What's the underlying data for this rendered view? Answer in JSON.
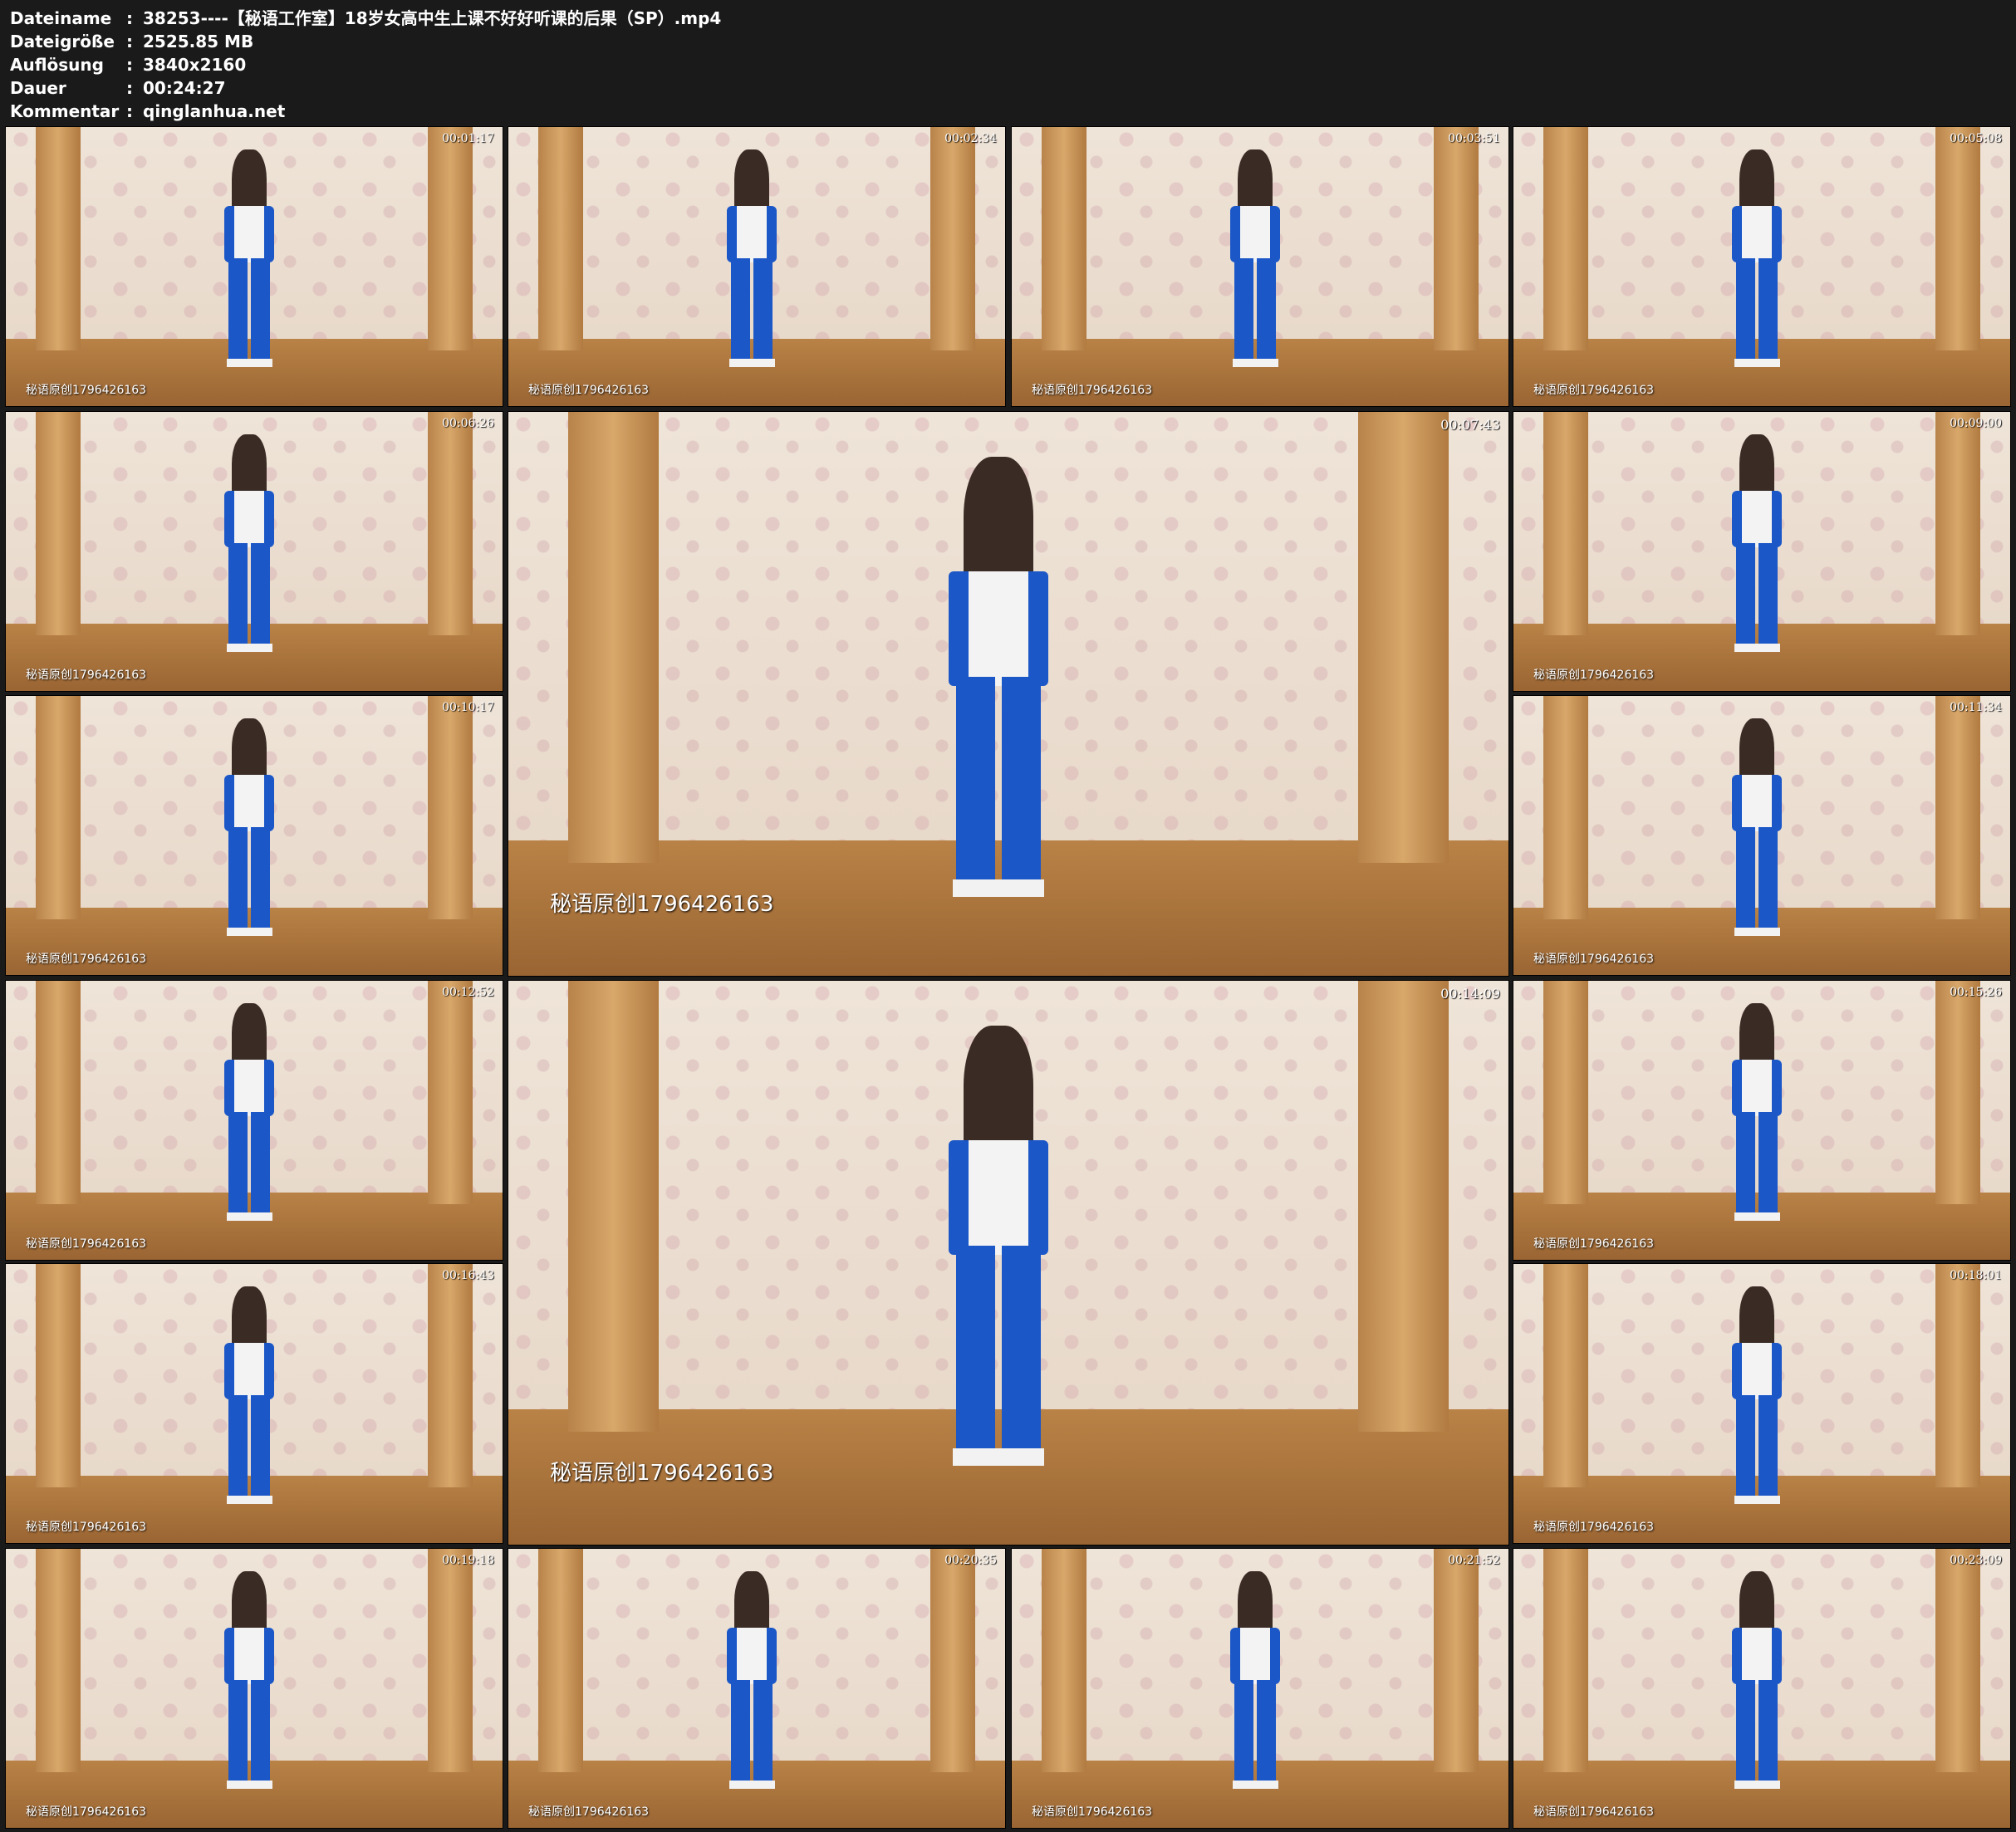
{
  "file_info": [
    {
      "key": "Dateiname",
      "value": "38253----【秘语工作室】18岁女高中生上课不好好听课的后果（SP）.mp4"
    },
    {
      "key": "Dateigröße",
      "value": "2525.85 MB"
    },
    {
      "key": "Auflösung",
      "value": "3840x2160"
    },
    {
      "key": "Dauer",
      "value": "00:24:27"
    },
    {
      "key": "Kommentar",
      "value": "qinglanhua.net"
    }
  ],
  "separator": ":",
  "watermark": "秘语原创1796426163",
  "thumbnails": [
    {
      "timestamp": "00:01:17"
    },
    {
      "timestamp": "00:02:34"
    },
    {
      "timestamp": "00:03:51"
    },
    {
      "timestamp": "00:05:08"
    },
    {
      "timestamp": "00:06:26"
    },
    {
      "timestamp": "00:07:43"
    },
    {
      "timestamp": "00:09:00"
    },
    {
      "timestamp": "00:10:17"
    },
    {
      "timestamp": "00:11:34"
    },
    {
      "timestamp": "00:12:52"
    },
    {
      "timestamp": "00:14:09"
    },
    {
      "timestamp": "00:15:26"
    },
    {
      "timestamp": "00:16:43"
    },
    {
      "timestamp": "00:18:01"
    },
    {
      "timestamp": "00:19:18"
    },
    {
      "timestamp": "00:20:35"
    },
    {
      "timestamp": "00:21:52"
    },
    {
      "timestamp": "00:23:09"
    }
  ]
}
